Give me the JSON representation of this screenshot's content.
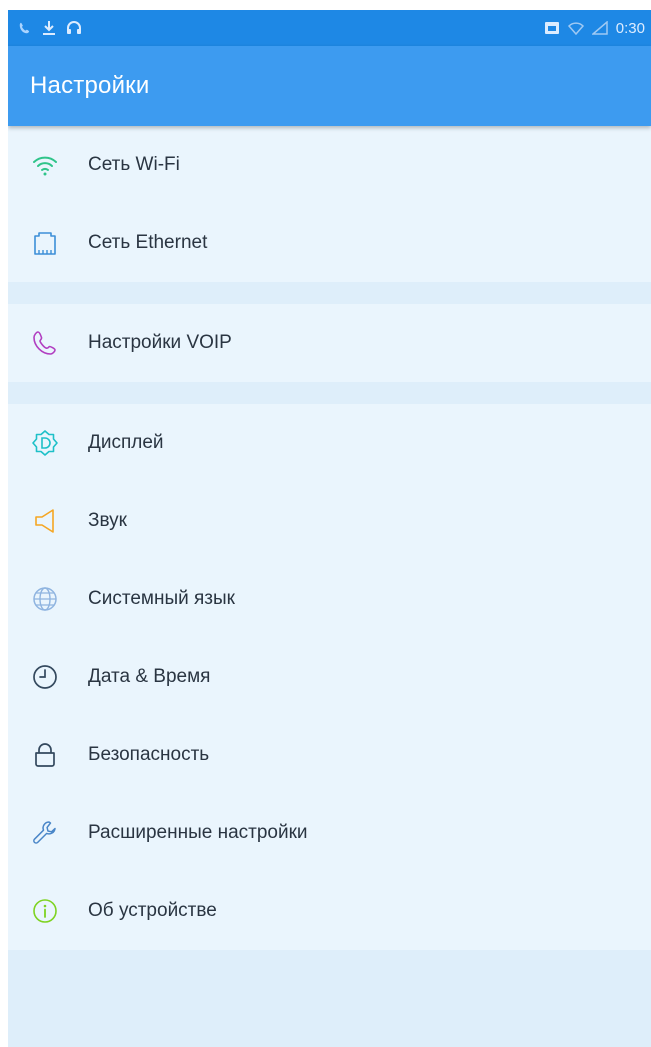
{
  "statusbar": {
    "time": "0:30",
    "left_icons": [
      "phone-icon",
      "download-icon",
      "headset-icon"
    ],
    "right_icons": [
      "sim-icon",
      "wifi-signal-icon",
      "cell-signal-icon"
    ]
  },
  "header": {
    "title": "Настройки"
  },
  "groups": [
    {
      "items": [
        {
          "label": "Сеть Wi-Fi",
          "icon": "wifi-icon",
          "color": "#2fc48a"
        },
        {
          "label": "Сеть Ethernet",
          "icon": "ethernet-icon",
          "color": "#3c8fd8"
        }
      ]
    },
    {
      "items": [
        {
          "label": "Настройки VOIP",
          "icon": "phone-icon",
          "color": "#b13ec1"
        }
      ]
    },
    {
      "items": [
        {
          "label": "Дисплей",
          "icon": "display-icon",
          "color": "#1ec0c8"
        },
        {
          "label": "Звук",
          "icon": "speaker-icon",
          "color": "#f5a623"
        },
        {
          "label": "Системный язык",
          "icon": "globe-icon",
          "color": "#8fb4e0"
        },
        {
          "label": "Дата & Время",
          "icon": "clock-icon",
          "color": "#34495e"
        },
        {
          "label": "Безопасность",
          "icon": "lock-icon",
          "color": "#34495e"
        },
        {
          "label": "Расширенные настройки",
          "icon": "wrench-icon",
          "color": "#4a86c8"
        },
        {
          "label": "Об устройстве",
          "icon": "info-icon",
          "color": "#7ed321"
        }
      ]
    }
  ]
}
